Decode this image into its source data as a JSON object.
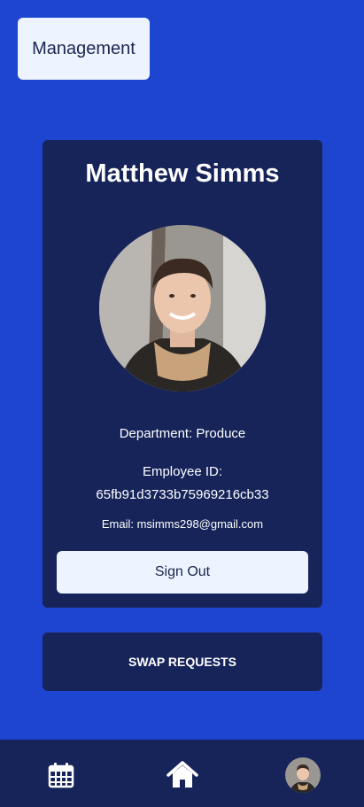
{
  "header": {
    "management_label": "Management"
  },
  "profile": {
    "name": "Matthew Simms",
    "department": "Department: Produce",
    "employee_id_label": "Employee ID:",
    "employee_id": "65fb91d3733b75969216cb33",
    "email": "Email: msimms298@gmail.com",
    "sign_out_label": "Sign Out"
  },
  "swap_requests_label": "SWAP REQUESTS",
  "nav": {
    "items": [
      {
        "icon": "calendar-icon"
      },
      {
        "icon": "home-icon"
      },
      {
        "icon": "profile-avatar"
      }
    ]
  },
  "colors": {
    "background": "#1d45cf",
    "card": "#17245a",
    "button_light": "#eef4ff"
  }
}
